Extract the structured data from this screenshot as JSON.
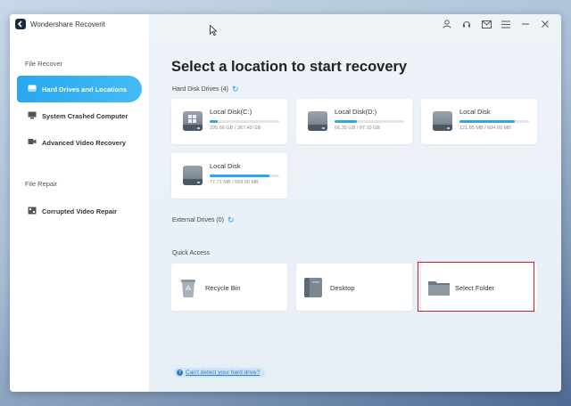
{
  "app": {
    "title": "Wondershare Recoverit",
    "accent": "#2aa8ef",
    "highlight_color": "#c0262b"
  },
  "topbar": {
    "icons": [
      "user-icon",
      "headset-icon",
      "mail-icon",
      "menu-icon",
      "minimize-icon",
      "close-icon"
    ]
  },
  "sidebar": {
    "section1": "File Recover",
    "section2": "File Repair",
    "items": [
      {
        "label": "Hard Drives and Locations",
        "icon": "drive-icon",
        "active": true
      },
      {
        "label": "System Crashed Computer",
        "icon": "monitor-icon",
        "active": false
      },
      {
        "label": "Advanced Video Recovery",
        "icon": "video-camera-icon",
        "active": false
      },
      {
        "label": "Corrupted Video Repair",
        "icon": "video-repair-icon",
        "active": false
      }
    ]
  },
  "main": {
    "heading": "Select a location to start recovery",
    "hard_disk_label": "Hard Disk Drives (4)",
    "external_label": "External Drives (0)",
    "quick_access_label": "Quick Access",
    "drives": [
      {
        "name": "Local Disk(C:)",
        "size": "295.66 GB / 367.40 GB",
        "usage": 0.12,
        "windows": true
      },
      {
        "name": "Local Disk(D:)",
        "size": "66.35 GB / 97.10 GB",
        "usage": 0.32,
        "windows": false
      },
      {
        "name": "Local Disk",
        "size": "121.85 MB / 604.00 MB",
        "usage": 0.8,
        "windows": false
      },
      {
        "name": "Local Disk",
        "size": "77.71 MB / 569.00 MB",
        "usage": 0.86,
        "windows": false
      }
    ],
    "quick_access": [
      {
        "label": "Recycle Bin",
        "icon": "recycle-bin-icon"
      },
      {
        "label": "Desktop",
        "icon": "desktop-folder-icon"
      },
      {
        "label": "Select Folder",
        "icon": "folder-icon"
      }
    ],
    "help_link": "Can't detect your hard drive?"
  }
}
